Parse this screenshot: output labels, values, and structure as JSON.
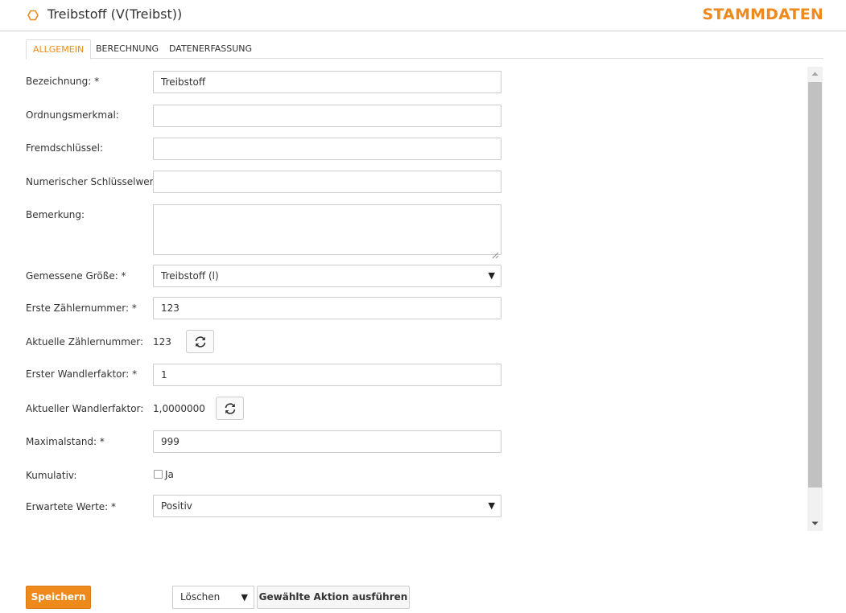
{
  "header": {
    "title": "Treibstoff (V(Treibst))",
    "brand": "STAMMDATEN",
    "accent_color": "#ee8a1c",
    "icon": "hexagon-outline-icon"
  },
  "tabs": [
    {
      "label": "ALLGEMEIN",
      "active": true
    },
    {
      "label": "BERECHNUNG",
      "active": false
    },
    {
      "label": "DATENERFASSUNG",
      "active": false
    }
  ],
  "form": {
    "bezeichnung": {
      "label": "Bezeichnung: *",
      "value": "Treibstoff"
    },
    "ordnungsmerkmal": {
      "label": "Ordnungsmerkmal:",
      "value": ""
    },
    "fremdschluessel": {
      "label": "Fremdschlüssel:",
      "value": ""
    },
    "numerischer_schluesselwert": {
      "label": "Numerischer Schlüsselwert:",
      "value": ""
    },
    "bemerkung": {
      "label": "Bemerkung:",
      "value": ""
    },
    "gemessene_groesse": {
      "label": "Gemessene Größe: *",
      "value": "Treibstoff (l)"
    },
    "erste_zaehlernummer": {
      "label": "Erste Zählernummer: *",
      "value": "123"
    },
    "aktuelle_zaehlernummer": {
      "label": "Aktuelle Zählernummer:",
      "value": "123"
    },
    "erster_wandlerfaktor": {
      "label": "Erster Wandlerfaktor: *",
      "value": "1"
    },
    "aktueller_wandlerfaktor": {
      "label": "Aktueller Wandlerfaktor:",
      "value": "1,0000000"
    },
    "maximalstand": {
      "label": "Maximalstand: *",
      "value": "999"
    },
    "kumulativ": {
      "label": "Kumulativ:",
      "checkbox_label": "Ja",
      "checked": false
    },
    "erwartete_werte": {
      "label": "Erwartete Werte: *",
      "value": "Positiv"
    }
  },
  "footer": {
    "save_label": "Speichern",
    "action_select_value": "Löschen",
    "action_button_label": "Gewählte Aktion ausführen"
  }
}
